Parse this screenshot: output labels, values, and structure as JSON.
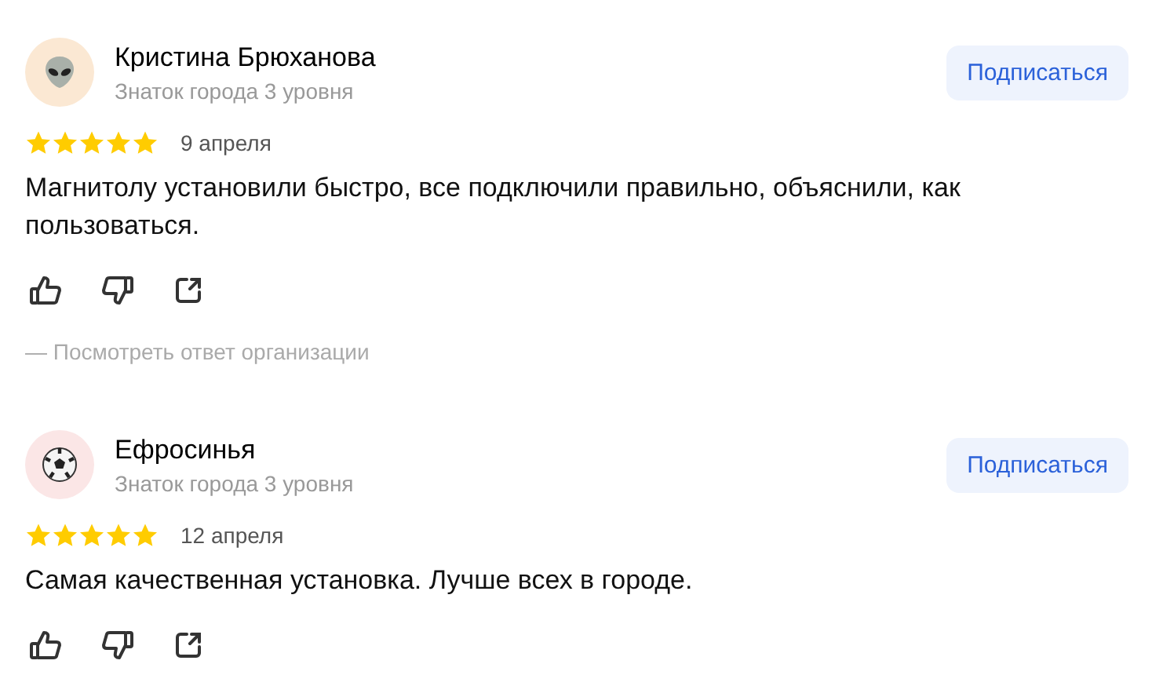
{
  "reviews": [
    {
      "author": "Кристина Брюханова",
      "badge": "Знаток города 3 уровня",
      "avatar": {
        "kind": "alien",
        "color": "#fbe8d3"
      },
      "subscribe": "Подписаться",
      "stars": 5,
      "date": "9 апреля",
      "text": "Магнитолу установили быстро, все подключили правильно, объяснили, как пользоваться.",
      "response_link": "— Посмотреть ответ организации"
    },
    {
      "author": "Ефросинья",
      "badge": "Знаток города 3 уровня",
      "avatar": {
        "kind": "ball",
        "color": "#fbe6e6"
      },
      "subscribe": "Подписаться",
      "stars": 5,
      "date": "12 апреля",
      "text": "Самая качественная установка. Лучше всех в городе."
    }
  ]
}
